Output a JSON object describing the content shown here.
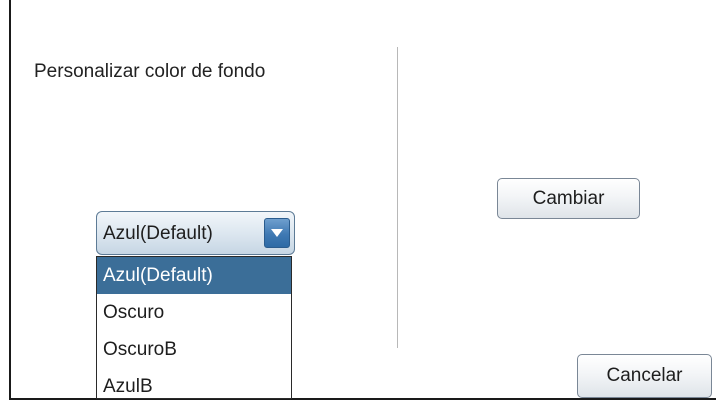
{
  "panel": {
    "label": "Personalizar color de fondo"
  },
  "combo": {
    "selected": "Azul(Default)",
    "options": [
      {
        "label": "Azul(Default)",
        "selected": true
      },
      {
        "label": "Oscuro",
        "selected": false
      },
      {
        "label": "OscuroB",
        "selected": false
      },
      {
        "label": "AzulB",
        "selected": false
      }
    ]
  },
  "buttons": {
    "change": "Cambiar",
    "cancel": "Cancelar"
  },
  "colors": {
    "selection": "#3b6e98",
    "arrow_button": "#3f79b3"
  },
  "icons": {
    "combo_arrow": "chevron-down-icon"
  }
}
